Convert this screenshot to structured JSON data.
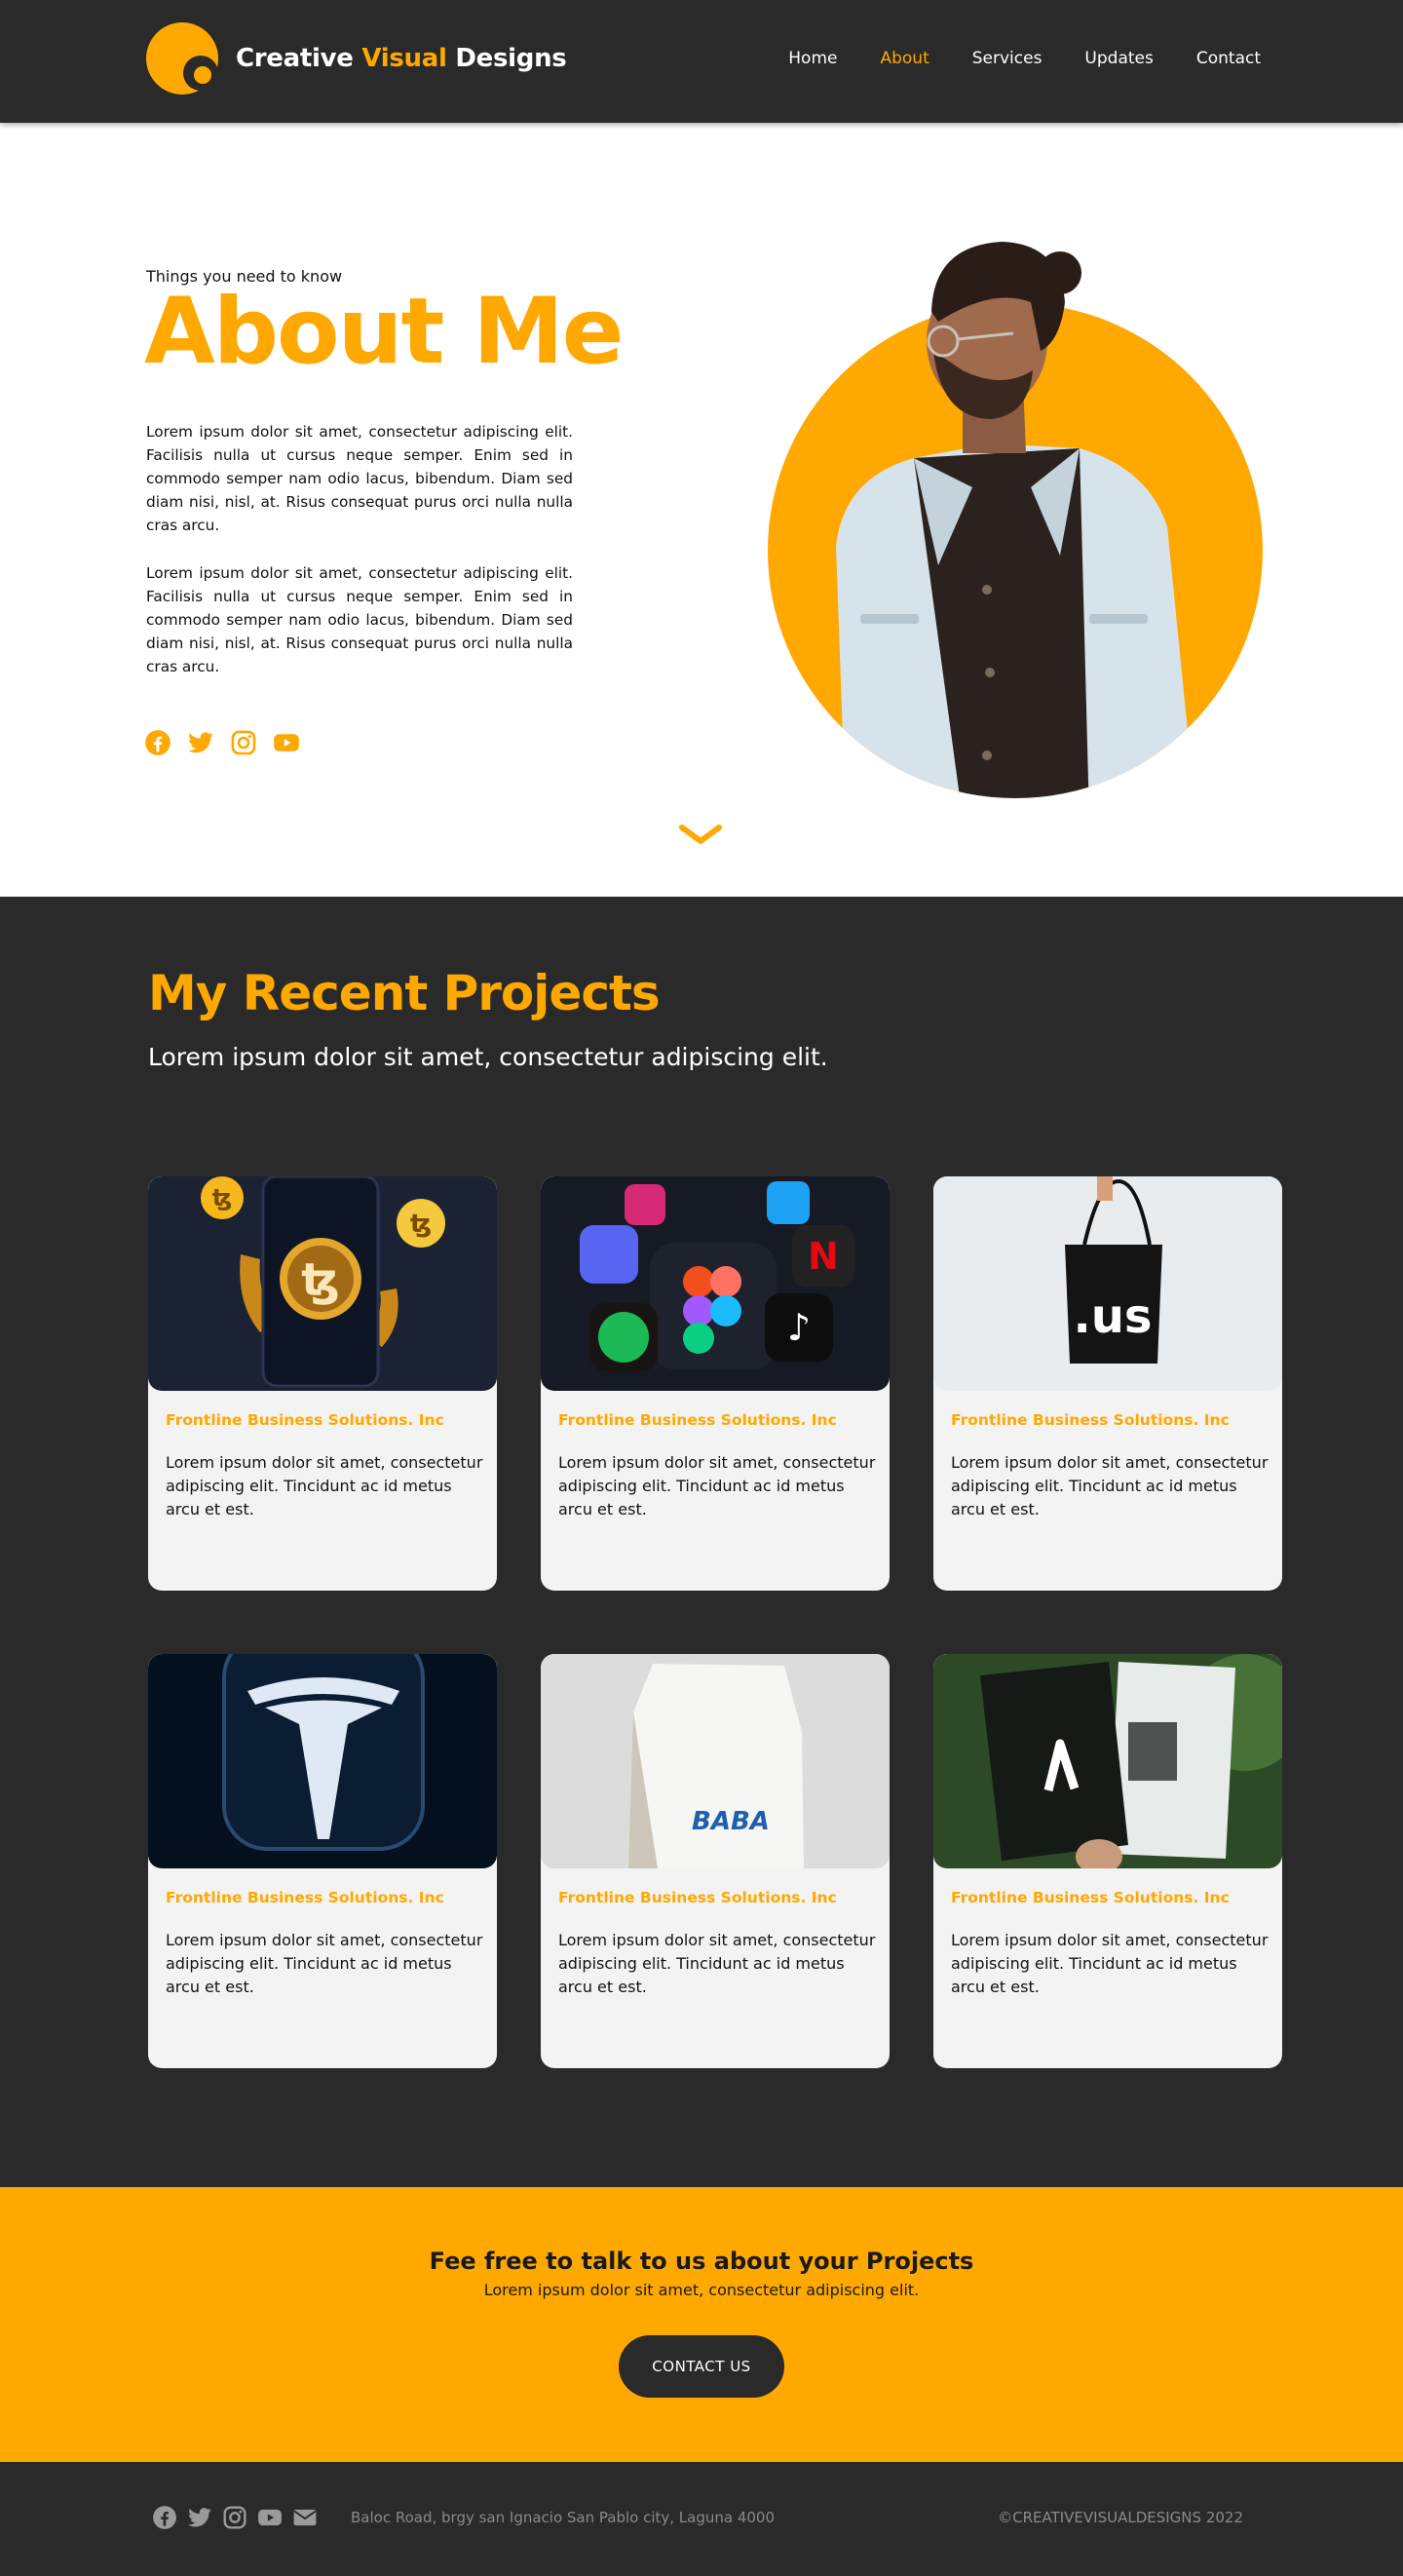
{
  "brand": {
    "name_part1": "Creative",
    "name_accent": "Visual",
    "name_part2": "Designs",
    "accent_color": "#ffa800",
    "dark_color": "#2a2a2a"
  },
  "nav": {
    "items": [
      {
        "label": "Home",
        "active": false
      },
      {
        "label": "About",
        "active": true
      },
      {
        "label": "Services",
        "active": false
      },
      {
        "label": "Updates",
        "active": false
      },
      {
        "label": "Contact",
        "active": false
      }
    ]
  },
  "hero": {
    "eyebrow": "Things you need to know",
    "title": "About Me",
    "paragraph1": "Lorem ipsum dolor sit amet, consectetur adipiscing elit. Facilisis nulla ut cursus neque semper. Enim sed in commodo semper nam odio lacus, bibendum. Diam sed diam nisi, nisl, at. Risus consequat purus orci nulla nulla cras arcu.",
    "paragraph2": "Lorem ipsum dolor sit amet, consectetur adipiscing elit. Facilisis nulla ut cursus neque semper. Enim sed in commodo semper nam odio lacus, bibendum. Diam sed diam nisi, nisl, at. Risus consequat purus orci nulla nulla cras arcu.",
    "social_icons": [
      "facebook-icon",
      "twitter-icon",
      "instagram-icon",
      "youtube-icon"
    ]
  },
  "projects": {
    "title": "My Recent Projects",
    "subtitle": "Lorem ipsum dolor sit amet, consectetur adipiscing elit.",
    "cards": [
      {
        "image": "tezos-phone-image",
        "name": "Frontline Business Solutions. Inc",
        "description": "Lorem ipsum dolor sit amet, consectetur adipiscing elit. Tincidunt ac id metus arcu et est."
      },
      {
        "image": "app-icons-image",
        "name": "Frontline Business Solutions. Inc",
        "description": "Lorem ipsum dolor sit amet, consectetur adipiscing elit. Tincidunt ac id metus arcu et est."
      },
      {
        "image": "tote-bag-image",
        "name": "Frontline Business Solutions. Inc",
        "description": "Lorem ipsum dolor sit amet, consectetur adipiscing elit. Tincidunt ac id metus arcu et est."
      },
      {
        "image": "tesla-icon-image",
        "name": "Frontline Business Solutions. Inc",
        "description": "Lorem ipsum dolor sit amet, consectetur adipiscing elit. Tincidunt ac id metus arcu et est."
      },
      {
        "image": "coffee-bag-image",
        "name": "Frontline Business Solutions. Inc",
        "description": "Lorem ipsum dolor sit amet, consectetur adipiscing elit. Tincidunt ac id metus arcu et est."
      },
      {
        "image": "business-card-image",
        "name": "Frontline Business Solutions. Inc",
        "description": "Lorem ipsum dolor sit amet, consectetur adipiscing elit. Tincidunt ac id metus arcu et est."
      }
    ],
    "image_text": {
      "tote_bag": ".us",
      "coffee_bag": "BABA"
    }
  },
  "cta": {
    "title": "Fee free to talk to us about your Projects",
    "subtitle": "Lorem ipsum dolor sit amet, consectetur adipiscing elit.",
    "button_label": "CONTACT US"
  },
  "footer": {
    "social_icons": [
      "facebook-icon",
      "twitter-icon",
      "instagram-icon",
      "youtube-icon",
      "email-icon"
    ],
    "address": "Baloc Road, brgy san Ignacio San Pablo city, Laguna 4000",
    "copyright": "©CREATIVEVISUALDESIGNS 2022"
  }
}
